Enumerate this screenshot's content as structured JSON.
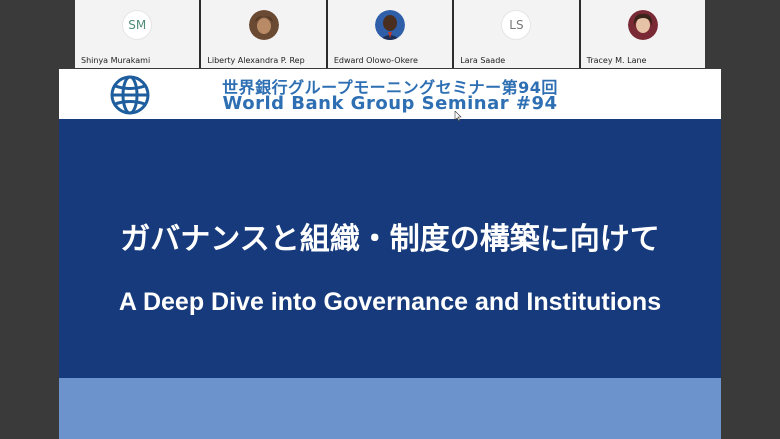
{
  "participants": [
    {
      "name": "Shinya Murakami",
      "initials": "SM",
      "avatar": "initials"
    },
    {
      "name": "Liberty Alexandra P. Rep",
      "initials": "",
      "avatar": "photo"
    },
    {
      "name": "Edward Olowo-Okere",
      "initials": "",
      "avatar": "photo"
    },
    {
      "name": "Lara Saade",
      "initials": "LS",
      "avatar": "initials"
    },
    {
      "name": "Tracey M. Lane",
      "initials": "",
      "avatar": "photo"
    }
  ],
  "slide": {
    "logo_icon": "world-bank-globe-icon",
    "seminar_jp": "世界銀行グループモーニングセミナー第94回",
    "seminar_en": "World Bank Group Seminar #94",
    "title_jp": "ガバナンスと組織・制度の構築に向けて",
    "title_en": "A Deep Dive into Governance and Institutions"
  },
  "colors": {
    "header_text": "#2e6fb3",
    "title_band": "#163a7c",
    "footer_band": "#6d93cc",
    "tile_bg": "#f3f3f3"
  }
}
